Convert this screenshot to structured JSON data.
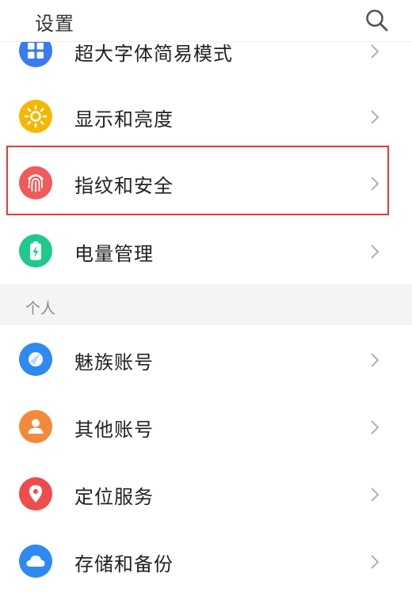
{
  "header": {
    "title": "设置"
  },
  "rows": [
    {
      "label": "超大字体简易模式",
      "icon": "grid-icon",
      "color": "#3a7bf2"
    },
    {
      "label": "显示和亮度",
      "icon": "sun-icon",
      "color": "#f6b700"
    },
    {
      "label": "指纹和安全",
      "icon": "fingerprint-icon",
      "color": "#f05a5a"
    },
    {
      "label": "电量管理",
      "icon": "battery-icon",
      "color": "#1fc98a"
    }
  ],
  "section": {
    "label": "个人"
  },
  "personal_rows": [
    {
      "label": "魅族账号",
      "icon": "meizu-account-icon",
      "color": "#2e8af0"
    },
    {
      "label": "其他账号",
      "icon": "person-icon",
      "color": "#f28a3c"
    },
    {
      "label": "定位服务",
      "icon": "location-pin-icon",
      "color": "#ef4c4c"
    },
    {
      "label": "存储和备份",
      "icon": "cloud-icon",
      "color": "#2e8af0"
    }
  ]
}
